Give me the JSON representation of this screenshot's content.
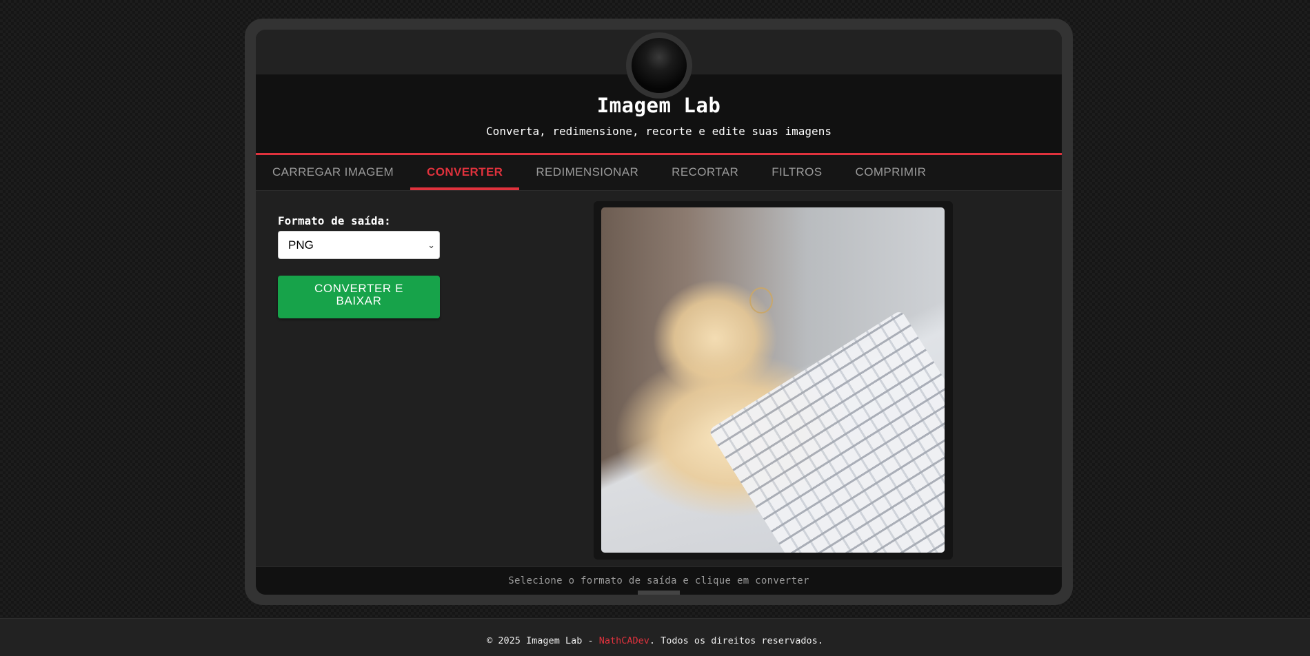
{
  "app": {
    "title": "Imagem Lab",
    "subtitle": "Converta, redimensione, recorte e edite suas imagens"
  },
  "tabs": [
    {
      "label": "CARREGAR IMAGEM",
      "active": false
    },
    {
      "label": "CONVERTER",
      "active": true
    },
    {
      "label": "REDIMENSIONAR",
      "active": false
    },
    {
      "label": "RECORTAR",
      "active": false
    },
    {
      "label": "FILTROS",
      "active": false
    },
    {
      "label": "COMPRIMIR",
      "active": false
    }
  ],
  "converter": {
    "format_label": "Formato de saída:",
    "selected_format": "PNG",
    "convert_button": "CONVERTER E BAIXAR"
  },
  "status": {
    "message": "Selecione o formato de saída e clique em converter"
  },
  "footer": {
    "prefix": "© 2025 Imagem Lab - ",
    "author": "NathCADev",
    "suffix": ". Todos os direitos reservados."
  },
  "colors": {
    "accent": "#e0323d",
    "button_green": "#17a34a",
    "background": "#161616"
  },
  "icons": {
    "select_arrow": "chevron-down-icon",
    "camera": "camera-notch"
  }
}
